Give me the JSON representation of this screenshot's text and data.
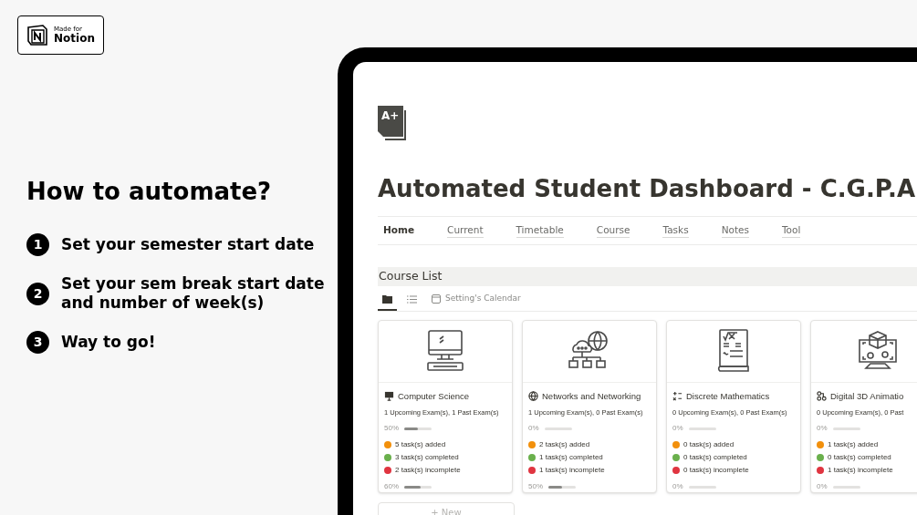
{
  "badge": {
    "small": "Made for",
    "big": "Notion"
  },
  "heading": "How to automate?",
  "steps": [
    {
      "number": "1",
      "text": "Set your semester start date"
    },
    {
      "number": "2",
      "text": "Set your sem break start date and number of week(s)"
    },
    {
      "number": "3",
      "text": "Way to go!"
    }
  ],
  "page": {
    "icon_text": "A+",
    "title": "Automated Student Dashboard - C.G.P.A",
    "nav": [
      {
        "label": "Home",
        "selected": true
      },
      {
        "label": "Current",
        "selected": false
      },
      {
        "label": "Timetable",
        "selected": false
      },
      {
        "label": "Course",
        "selected": false
      },
      {
        "label": "Tasks",
        "selected": false
      },
      {
        "label": "Notes",
        "selected": false
      },
      {
        "label": "Tool",
        "selected": false
      }
    ],
    "section": "Course List",
    "views": [
      {
        "kind": "gallery",
        "selected": true
      },
      {
        "kind": "list",
        "selected": false
      },
      {
        "kind": "calendar",
        "label": "Setting's Calendar",
        "selected": false
      }
    ],
    "cards": [
      {
        "kind": "computer",
        "title": "Computer Science",
        "exams": "1 Upcoming Exam(s), 1 Past Exam(s)",
        "exam_pct": "50%",
        "exam_progress": {
          "level": 0.5
        },
        "added": "5 task(s) added",
        "completed": "3 task(s) completed",
        "incomplete": "2 task(s) incomplete",
        "task_pct": "60%",
        "task_progress": {
          "level": 0.6
        }
      },
      {
        "kind": "network",
        "title": "Networks and Networking",
        "exams": "1 Upcoming Exam(s), 0 Past Exam(s)",
        "exam_pct": "0%",
        "exam_progress": {
          "level": 0
        },
        "added": "2 task(s) added",
        "completed": "1 task(s) completed",
        "incomplete": "1 task(s) incomplete",
        "task_pct": "50%",
        "task_progress": {
          "level": 0.5
        }
      },
      {
        "kind": "math",
        "title": "Discrete Mathematics",
        "exams": "0 Upcoming Exam(s), 0 Past Exam(s)",
        "exam_pct": "0%",
        "exam_progress": {
          "level": 0
        },
        "added": "0 task(s) added",
        "completed": "0 task(s) completed",
        "incomplete": "0 task(s) incomplete",
        "task_pct": "0%",
        "task_progress": {
          "level": 0
        }
      },
      {
        "kind": "animation",
        "title": "Digital 3D Animatio",
        "exams": "0 Upcoming Exam(s), 0 Past",
        "exam_pct": "0%",
        "exam_progress": {
          "level": 0
        },
        "added": "1 task(s) added",
        "completed": "0 task(s) completed",
        "incomplete": "1 task(s) incomplete",
        "task_pct": "0%",
        "task_progress": {
          "level": 0
        }
      }
    ],
    "new_label": "+ New"
  }
}
